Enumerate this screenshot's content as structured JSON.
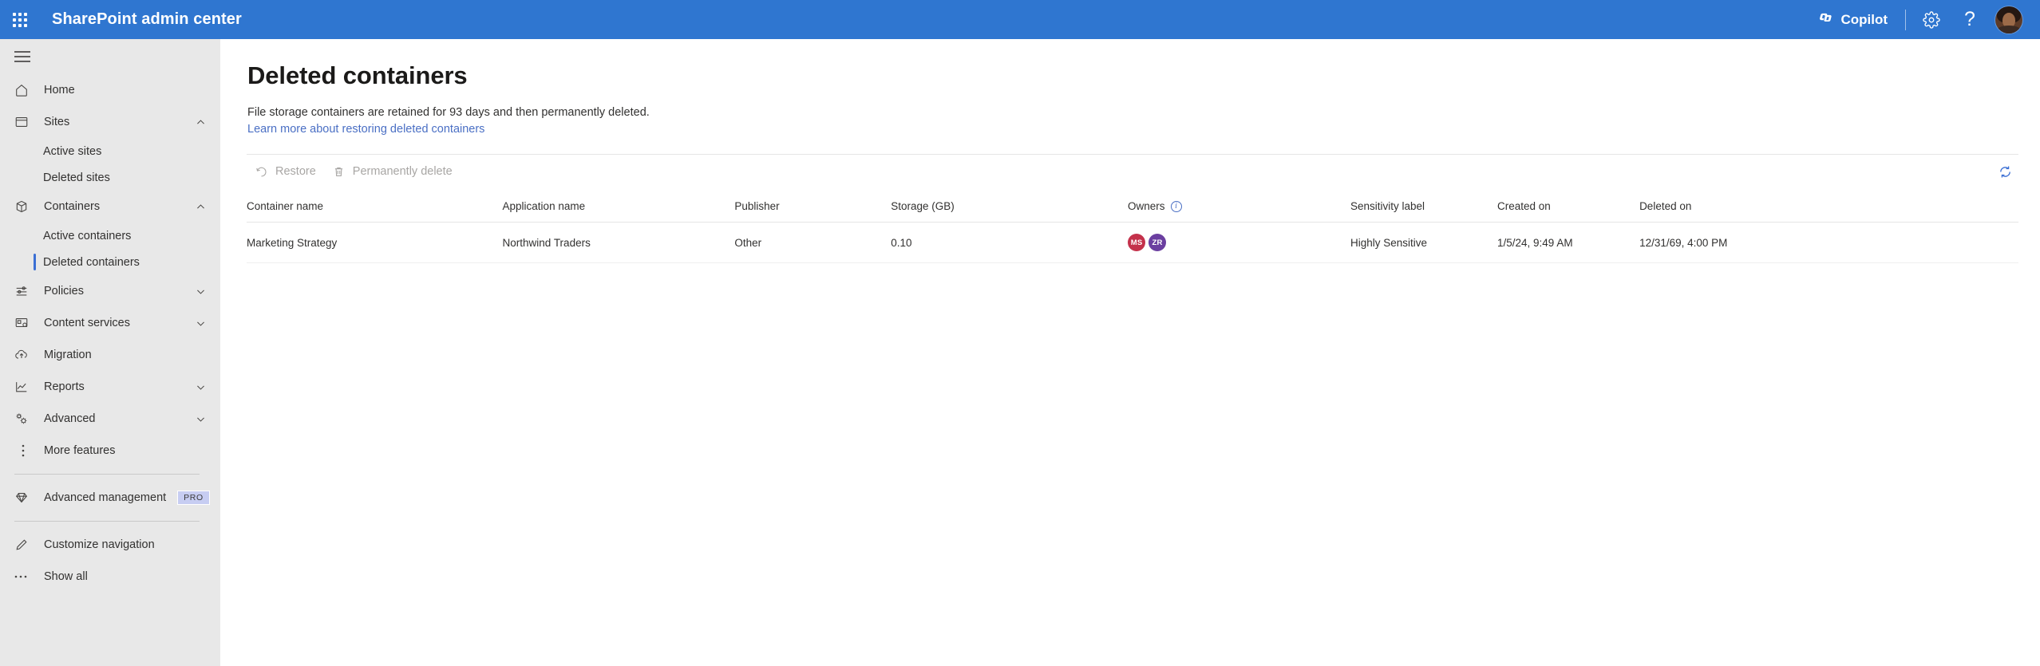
{
  "header": {
    "waffle_icon": "app-launcher-waffle-icon",
    "brand": "SharePoint admin center",
    "copilot_label": "Copilot",
    "copilot_icon": "copilot-icon",
    "settings_icon": "gear-icon",
    "help_icon": "question-mark-icon",
    "help_glyph": "?",
    "avatar_name": "user-avatar",
    "brand_color": "#2f76d0"
  },
  "sidebar": {
    "hamburger_icon": "hamburger-menu-icon",
    "background_color": "#e8e8e8",
    "selection_color": "#3b6fd4",
    "items": [
      {
        "label": "Home",
        "icon": "home-icon",
        "type": "item",
        "expandable": false
      },
      {
        "label": "Sites",
        "icon": "sites-icon",
        "type": "item",
        "expandable": true,
        "expanded": true
      },
      {
        "label": "Active sites",
        "icon": "",
        "type": "sub",
        "selected": false
      },
      {
        "label": "Deleted sites",
        "icon": "",
        "type": "sub",
        "selected": false
      },
      {
        "label": "Containers",
        "icon": "containers-box-icon",
        "type": "item",
        "expandable": true,
        "expanded": true
      },
      {
        "label": "Active containers",
        "icon": "",
        "type": "sub",
        "selected": false
      },
      {
        "label": "Deleted containers",
        "icon": "",
        "type": "sub",
        "selected": true
      },
      {
        "label": "Policies",
        "icon": "sliders-icon",
        "type": "item",
        "expandable": true,
        "expanded": false
      },
      {
        "label": "Content services",
        "icon": "content-services-icon",
        "type": "item",
        "expandable": true,
        "expanded": false
      },
      {
        "label": "Migration",
        "icon": "cloud-upload-icon",
        "type": "item",
        "expandable": false
      },
      {
        "label": "Reports",
        "icon": "chart-line-icon",
        "type": "item",
        "expandable": true,
        "expanded": false
      },
      {
        "label": "Advanced",
        "icon": "gears-icon",
        "type": "item",
        "expandable": true,
        "expanded": false
      },
      {
        "label": "More features",
        "icon": "more-vertical-icon",
        "type": "item",
        "expandable": false
      }
    ],
    "advanced_management": {
      "label": "Advanced management",
      "icon": "diamond-icon",
      "badge": "PRO"
    },
    "customize_navigation": {
      "label": "Customize navigation",
      "icon": "pencil-icon"
    },
    "show_all": {
      "label": "Show all",
      "icon": "ellipsis-icon"
    }
  },
  "main": {
    "title": "Deleted containers",
    "description": "File storage containers are retained for 93 days and then permanently deleted.",
    "link": "Learn more about restoring deleted containers",
    "toolbar": {
      "restore_label": "Restore",
      "restore_icon": "restore-arrow-icon",
      "delete_label": "Permanently delete",
      "delete_icon": "trash-icon",
      "refresh_icon": "refresh-icon",
      "refresh_color": "#3b6fd4"
    },
    "table": {
      "columns": [
        "Container name",
        "Application name",
        "Publisher",
        "Storage (GB)",
        "Owners",
        "Sensitivity label",
        "Created on",
        "Deleted on"
      ],
      "owners_info_icon": "info-icon",
      "rows": [
        {
          "container_name": "Marketing Strategy",
          "application_name": "Northwind Traders",
          "publisher": "Other",
          "storage_gb": "0.10",
          "owners": [
            {
              "initials": "MS",
              "color": "#c4314b"
            },
            {
              "initials": "ZR",
              "color": "#6b3fa0"
            }
          ],
          "sensitivity_label": "Highly Sensitive",
          "created_on": "1/5/24, 9:49 AM",
          "deleted_on": "12/31/69, 4:00 PM"
        }
      ]
    }
  }
}
